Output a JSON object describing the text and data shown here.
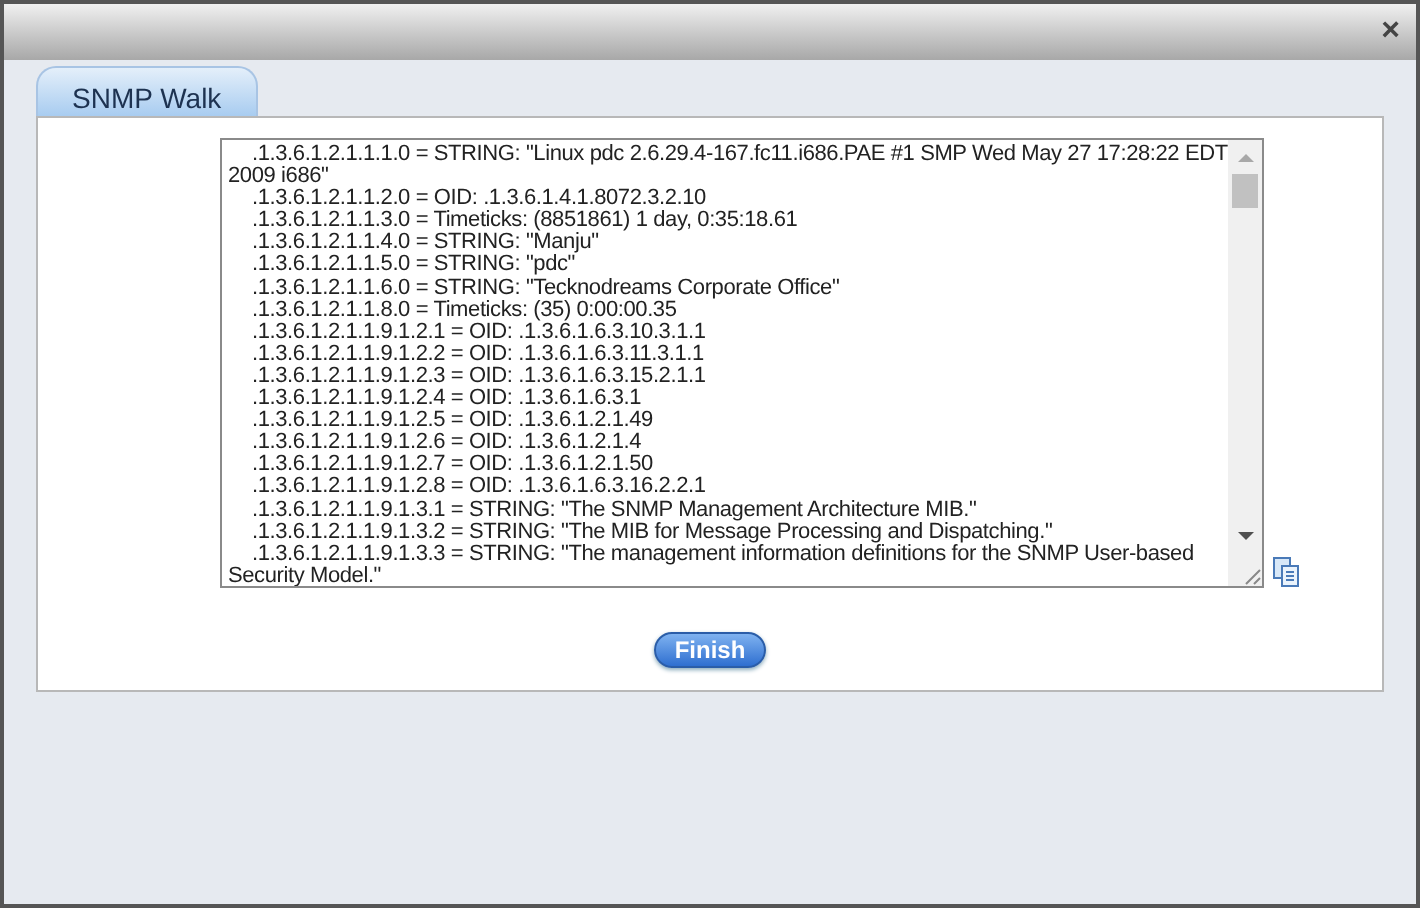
{
  "window": {
    "close": "×"
  },
  "tabs": [
    {
      "label": "SNMP Walk",
      "selected": true
    }
  ],
  "output": {
    "lines": [
      ".1.3.6.1.2.1.1.1.0 = STRING: \"Linux pdc 2.6.29.4-167.fc11.i686.PAE #1 SMP Wed May 27 17:28:22 EDT 2009 i686\"",
      ".1.3.6.1.2.1.1.2.0 = OID: .1.3.6.1.4.1.8072.3.2.10",
      ".1.3.6.1.2.1.1.3.0 = Timeticks: (8851861) 1 day, 0:35:18.61",
      ".1.3.6.1.2.1.1.4.0 = STRING: \"Manju\"",
      ".1.3.6.1.2.1.1.5.0 = STRING: \"pdc\"",
      ".1.3.6.1.2.1.1.6.0 = STRING: \"Tecknodreams Corporate Office\"",
      ".1.3.6.1.2.1.1.8.0 = Timeticks: (35) 0:00:00.35",
      ".1.3.6.1.2.1.1.9.1.2.1 = OID: .1.3.6.1.6.3.10.3.1.1",
      ".1.3.6.1.2.1.1.9.1.2.2 = OID: .1.3.6.1.6.3.11.3.1.1",
      ".1.3.6.1.2.1.1.9.1.2.3 = OID: .1.3.6.1.6.3.15.2.1.1",
      ".1.3.6.1.2.1.1.9.1.2.4 = OID: .1.3.6.1.6.3.1",
      ".1.3.6.1.2.1.1.9.1.2.5 = OID: .1.3.6.1.2.1.49",
      ".1.3.6.1.2.1.1.9.1.2.6 = OID: .1.3.6.1.2.1.4",
      ".1.3.6.1.2.1.1.9.1.2.7 = OID: .1.3.6.1.2.1.50",
      ".1.3.6.1.2.1.1.9.1.2.8 = OID: .1.3.6.1.6.3.16.2.2.1",
      ".1.3.6.1.2.1.1.9.1.3.1 = STRING: \"The SNMP Management Architecture MIB.\"",
      ".1.3.6.1.2.1.1.9.1.3.2 = STRING: \"The MIB for Message Processing and Dispatching.\"",
      ".1.3.6.1.2.1.1.9.1.3.3 = STRING: \"The management information definitions for the SNMP User-based Security Model.\""
    ]
  },
  "buttons": [
    "Finish"
  ]
}
